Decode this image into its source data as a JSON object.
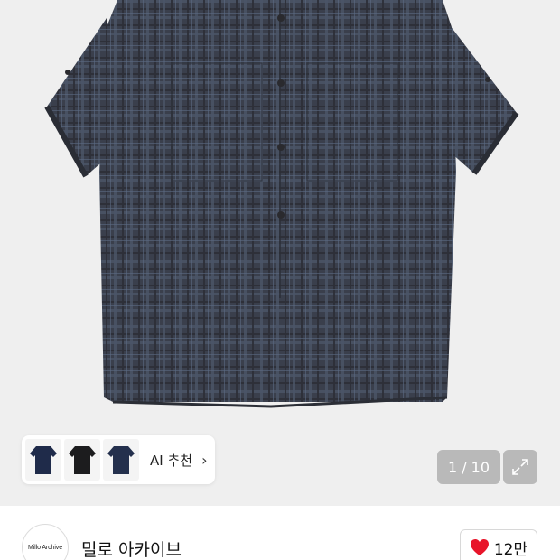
{
  "gallery": {
    "counter": "1 / 10",
    "recommend_label": "AI 추천",
    "thumbnails": [
      "navy-shirt",
      "black-shirt",
      "navy-shirt"
    ]
  },
  "seller": {
    "name": "밀로 아카이브",
    "avatar_text": "Millo Archive"
  },
  "like": {
    "count": "12만",
    "color": "#e8152a"
  }
}
